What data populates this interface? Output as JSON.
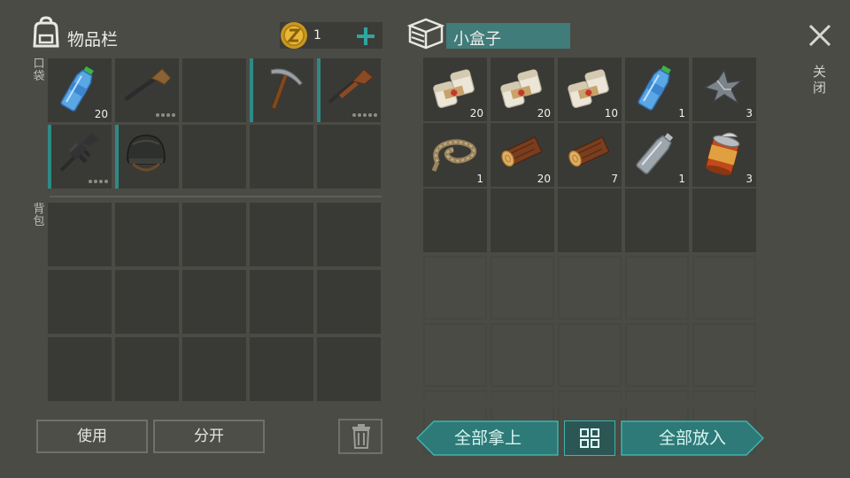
{
  "inventory": {
    "title": "物品栏",
    "coins": "1",
    "pocket_label": "口袋",
    "backpack_label": "背包",
    "pocket_slots": [
      {
        "item": "water-bottle",
        "count": "20",
        "equip": false,
        "dots": 0
      },
      {
        "item": "shotgun",
        "count": "",
        "equip": false,
        "dots": 4
      },
      {
        "item": "",
        "count": "",
        "equip": false,
        "dots": 0
      },
      {
        "item": "pickaxe",
        "count": "",
        "equip": true,
        "dots": 0
      },
      {
        "item": "hunting-rifle",
        "count": "",
        "equip": true,
        "dots": 5
      },
      {
        "item": "assault-rifle",
        "count": "",
        "equip": true,
        "dots": 4
      },
      {
        "item": "helmet",
        "count": "",
        "equip": true,
        "dots": 0
      },
      {
        "item": "",
        "count": "",
        "equip": false,
        "dots": 0
      },
      {
        "item": "",
        "count": "",
        "equip": false,
        "dots": 0
      },
      {
        "item": "",
        "count": "",
        "equip": false,
        "dots": 0
      }
    ],
    "backpack_slot_count": 15,
    "use_label": "使用",
    "split_label": "分开"
  },
  "container": {
    "title": "小盒子",
    "slots": [
      {
        "item": "bandage",
        "count": "20"
      },
      {
        "item": "bandage",
        "count": "20"
      },
      {
        "item": "bandage",
        "count": "10"
      },
      {
        "item": "water-bottle",
        "count": "1"
      },
      {
        "item": "scrap-metal",
        "count": "3"
      },
      {
        "item": "rope",
        "count": "1"
      },
      {
        "item": "log",
        "count": "20"
      },
      {
        "item": "log",
        "count": "7"
      },
      {
        "item": "empty-bottle",
        "count": "1"
      },
      {
        "item": "canned-food",
        "count": "3"
      },
      {
        "item": "",
        "count": ""
      },
      {
        "item": "",
        "count": ""
      },
      {
        "item": "",
        "count": ""
      },
      {
        "item": "",
        "count": ""
      },
      {
        "item": "",
        "count": ""
      }
    ],
    "locked_rows": 3,
    "take_all_label": "全部拿上",
    "put_all_label": "全部放入"
  },
  "close_label": "关闭",
  "colors": {
    "accent": "#2e8a86",
    "background": "#4a4b45",
    "slot": "#393a36"
  }
}
